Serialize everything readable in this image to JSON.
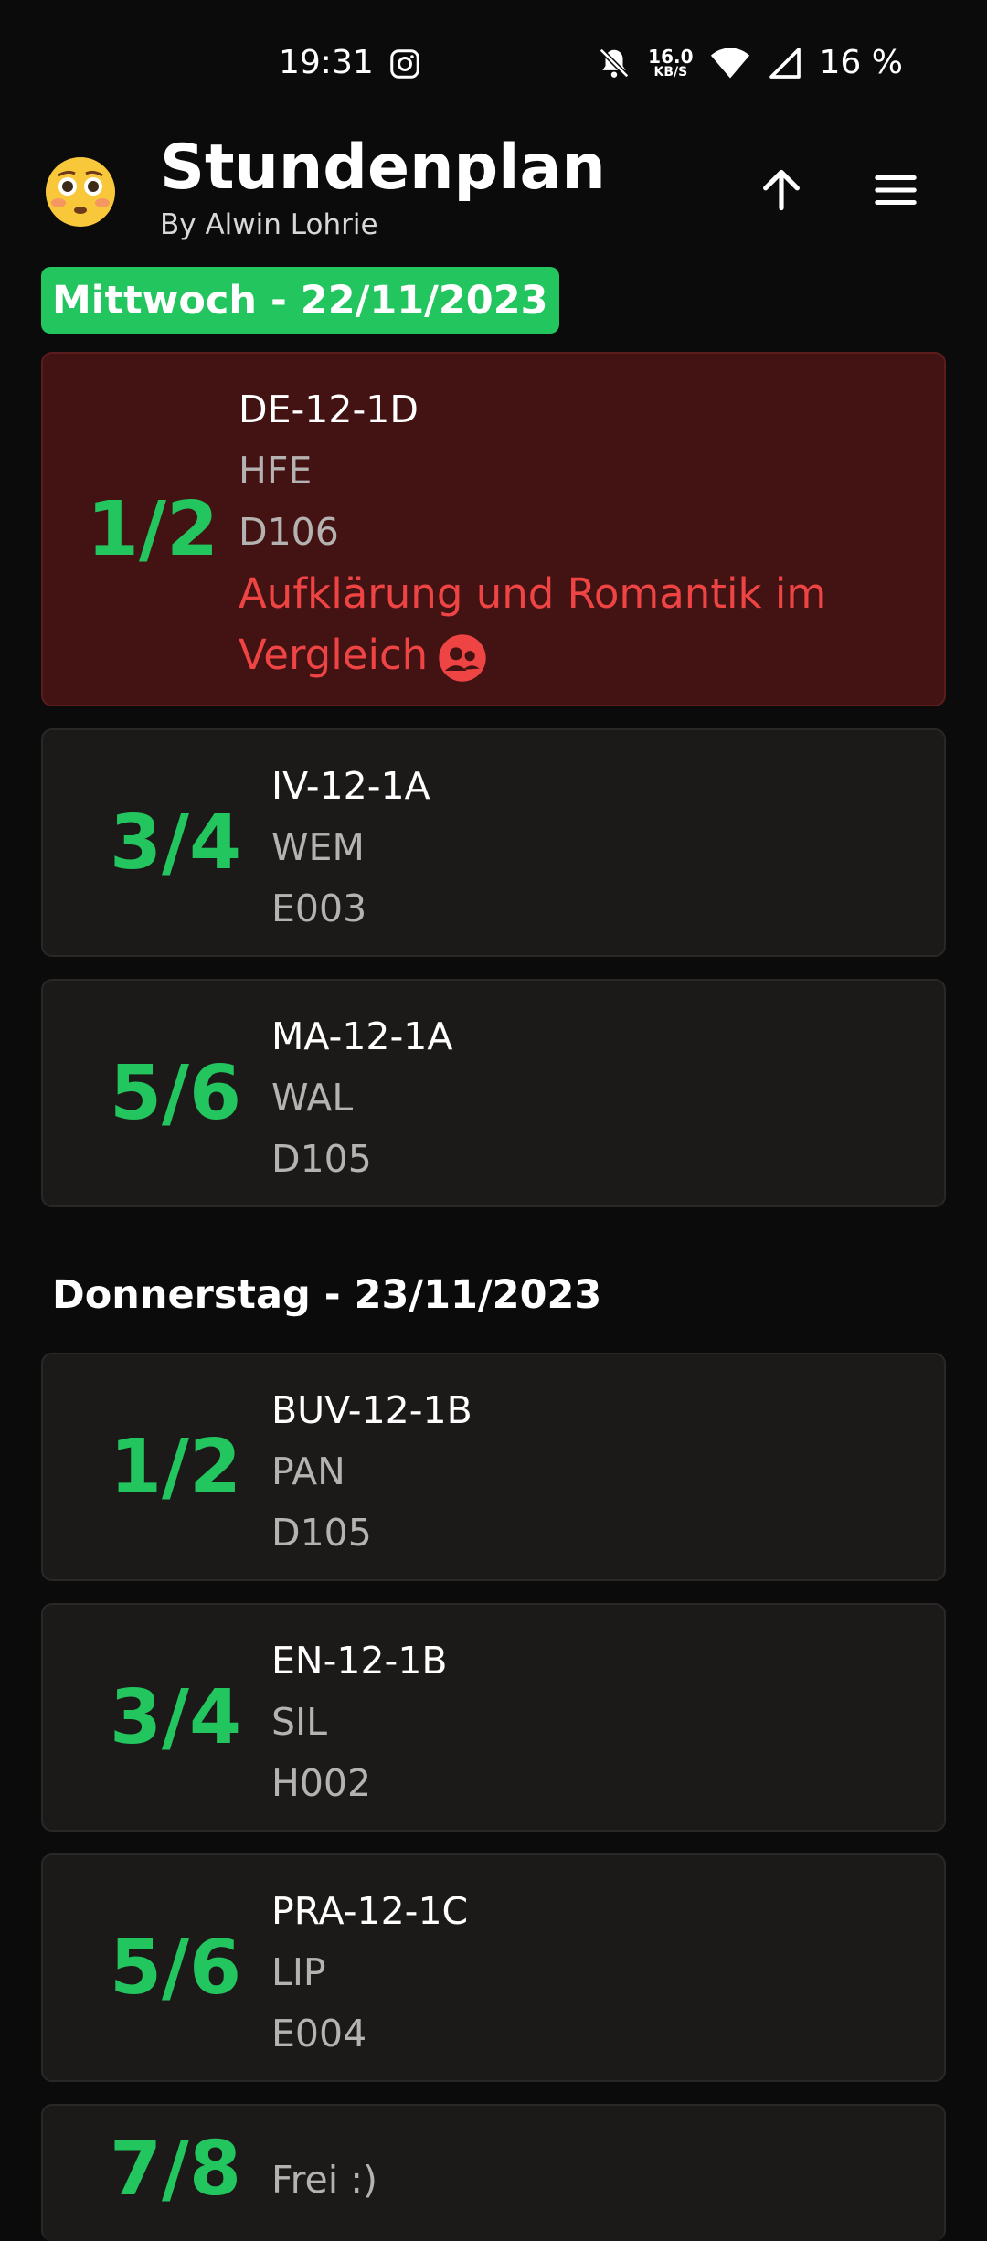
{
  "status": {
    "time": "19:31",
    "speed_value": "16.0",
    "speed_unit": "KB/S",
    "battery": "16 %"
  },
  "header": {
    "title": "Stundenplan",
    "subtitle": "By Alwin Lohrie",
    "emoji": "😳"
  },
  "days": [
    {
      "label": "Mittwoch - 22/11/2023",
      "lessons": [
        {
          "period": "1/2",
          "course": "DE-12-1D",
          "teacher": "HFE",
          "room": "D106",
          "note": "Aufklärung und Romantik im Vergleich"
        },
        {
          "period": "3/4",
          "course": "IV-12-1A",
          "teacher": "WEM",
          "room": "E003"
        },
        {
          "period": "5/6",
          "course": "MA-12-1A",
          "teacher": "WAL",
          "room": "D105"
        }
      ]
    },
    {
      "label": "Donnerstag - 23/11/2023",
      "lessons": [
        {
          "period": "1/2",
          "course": "BUV-12-1B",
          "teacher": "PAN",
          "room": "D105"
        },
        {
          "period": "3/4",
          "course": "EN-12-1B",
          "teacher": "SIL",
          "room": "H002"
        },
        {
          "period": "5/6",
          "course": "PRA-12-1C",
          "teacher": "LIP",
          "room": "E004"
        },
        {
          "period": "7/8",
          "teacher": "Frei :)"
        }
      ]
    }
  ],
  "colors": {
    "accent": "#22c55e",
    "alert": "#ef4444",
    "card": "#1c1a19",
    "card_alert": "#431213"
  },
  "icons": {
    "status_instagram": "instagram-icon",
    "status_bell_off": "bell-off-icon",
    "status_wifi": "wifi-icon",
    "status_signal": "signal-icon",
    "header_up": "arrow-up-icon",
    "header_menu": "menu-icon",
    "note": "people-icon"
  }
}
